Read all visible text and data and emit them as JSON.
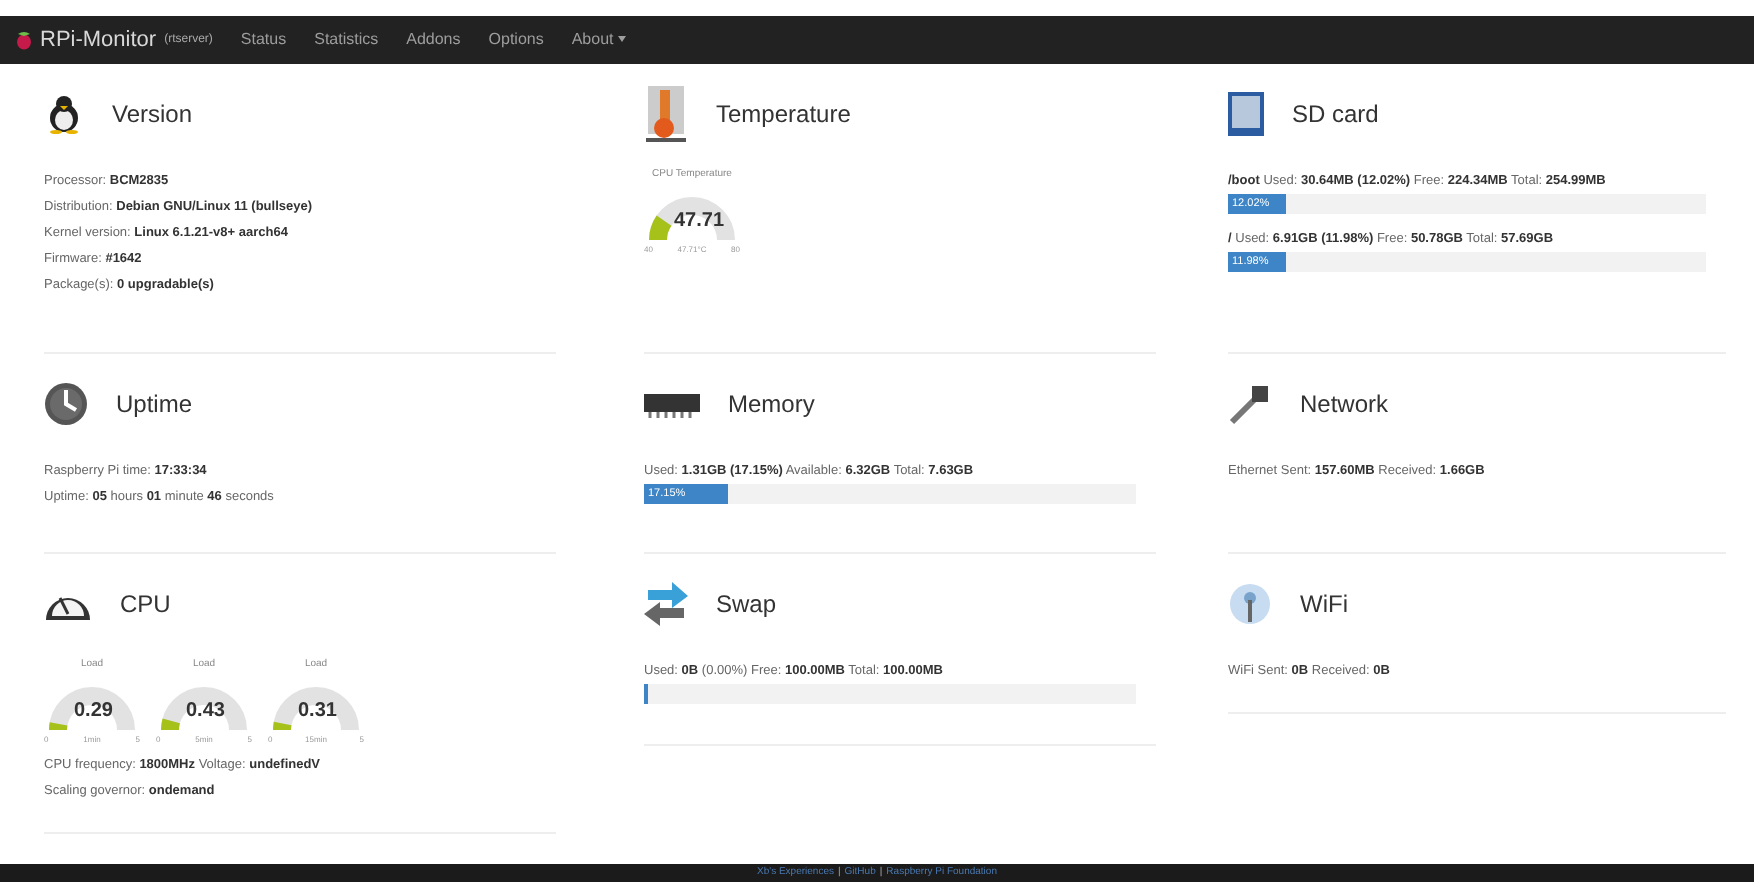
{
  "navbar": {
    "brand": "RPi-Monitor",
    "host": "(rtserver)",
    "items": [
      {
        "label": "Status",
        "selected": false
      },
      {
        "label": "Statistics",
        "selected": false
      },
      {
        "label": "Addons",
        "selected": false
      },
      {
        "label": "Options",
        "selected": false
      },
      {
        "label": "About",
        "selected": false,
        "dropdown": true
      }
    ]
  },
  "columns": [
    [
      {
        "title": "Version",
        "items": [
          {
            "kind": "text",
            "text": "Processor: **BCM2835**"
          },
          {
            "kind": "text",
            "text": "Distribution: **Debian GNU/Linux 11 (bullseye)**"
          },
          {
            "kind": "text",
            "text": "Kernel version: **Linux 6.1.21-v8+ aarch64**"
          },
          {
            "kind": "text",
            "text": "Firmware: **#1642**"
          },
          {
            "kind": "text",
            "text": "Package(s): **0 upgradable(s)**"
          }
        ]
      },
      {
        "title": "Uptime",
        "items": [
          {
            "kind": "text",
            "text": "Raspberry Pi time: **17:33:34**"
          },
          {
            "kind": "text",
            "text": "Uptime: **05** hours **01** minute **46** seconds"
          }
        ]
      },
      {
        "title": "CPU",
        "items": [
          {
            "kind": "gauges",
            "gauges": [
              {
                "caption": "Load",
                "value": "0.29",
                "min": "0",
                "unit": "1min",
                "max": "5"
              },
              {
                "caption": "Load",
                "value": "0.43",
                "min": "0",
                "unit": "5min",
                "max": "5"
              },
              {
                "caption": "Load",
                "value": "0.31",
                "min": "0",
                "unit": "15min",
                "max": "5"
              }
            ]
          },
          {
            "kind": "text",
            "text": "CPU frequency: **1800MHz** Voltage: **undefinedV**"
          },
          {
            "kind": "text",
            "text": "Scaling governor: **ondemand**"
          }
        ]
      }
    ],
    [
      {
        "title": "Temperature",
        "items": [
          {
            "kind": "gauges",
            "gauges": [
              {
                "caption": "CPU Temperature",
                "value": "47.71",
                "min": "40",
                "unit": "47.71°C",
                "max": "80"
              }
            ]
          }
        ]
      },
      {
        "title": "Memory",
        "items": [
          {
            "kind": "text",
            "text": "Used: **1.31GB** **(17.15%)** Available: **6.32GB** Total: **7.63GB**"
          },
          {
            "kind": "bar",
            "level": 0.1715,
            "label": "17.15%"
          }
        ]
      },
      {
        "title": "Swap",
        "items": [
          {
            "kind": "text",
            "text": "Used: **0B** (0.00%) Free: **100.00MB** Total: **100.00MB**"
          },
          {
            "kind": "bar",
            "level": 0
          }
        ]
      }
    ],
    [
      {
        "title": "SD card",
        "items": [
          {
            "kind": "text",
            "text": "**/boot** Used: **30.64MB** **(12.02%)** Free: **224.34MB** Total: **254.99MB**"
          },
          {
            "kind": "bar",
            "level": 0.1202,
            "label": "12.02%"
          },
          {
            "kind": "text",
            "text": "**/** Used: **6.91GB** **(11.98%)** Free: **50.78GB** Total: **57.69GB**"
          },
          {
            "kind": "bar",
            "level": 0.1198,
            "label": "11.98%"
          }
        ]
      },
      {
        "title": "Network",
        "items": [
          {
            "kind": "text",
            "text": "Ethernet Sent: **157.60MB** Received: **1.66GB**"
          }
        ]
      },
      {
        "title": "WiFi",
        "items": [
          {
            "kind": "text",
            "text": "WiFi Sent: **0B** Received: **0B**"
          }
        ]
      }
    ]
  ],
  "footer": {
    "links": [
      "Xb's Experiences",
      "GitHub",
      "Raspberry Pi Foundation"
    ],
    "separators": [
      "|",
      "|"
    ]
  }
}
